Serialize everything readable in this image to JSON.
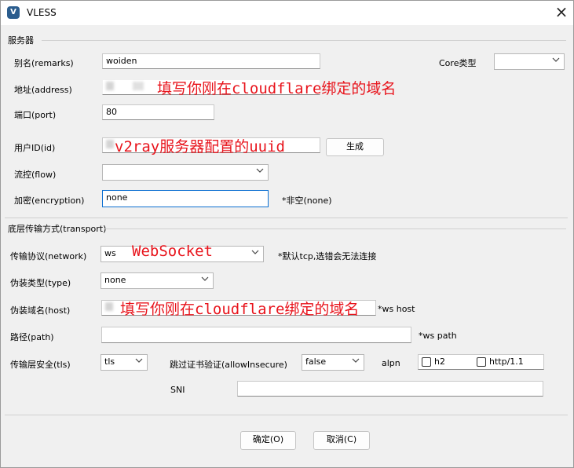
{
  "window": {
    "title": "VLESS",
    "icon": "V"
  },
  "server": {
    "section": "服务器",
    "remarks": {
      "label": "别名(remarks)",
      "value": "woiden"
    },
    "core": {
      "label": "Core类型",
      "value": ""
    },
    "address": {
      "label": "地址(address)",
      "annotation": "填写你刚在cloudflare绑定的域名"
    },
    "port": {
      "label": "端口(port)",
      "value": "80"
    },
    "uuid": {
      "label": "用户ID(id)",
      "annotation": "v2ray服务器配置的uuid",
      "generate": "生成"
    },
    "flow": {
      "label": "流控(flow)",
      "value": ""
    },
    "encryption": {
      "label": "加密(encryption)",
      "value": "none",
      "hint": "*非空(none)"
    }
  },
  "transport": {
    "section": "底层传输方式(transport)",
    "network": {
      "label": "传输协议(network)",
      "value": "ws",
      "annotation": "WebSocket",
      "hint": "*默认tcp,选错会无法连接"
    },
    "type": {
      "label": "伪装类型(type)",
      "value": "none"
    },
    "host": {
      "label": "伪装域名(host)",
      "annotation": "填写你刚在cloudflare绑定的域名",
      "hint": "*ws host"
    },
    "path": {
      "label": "路径(path)",
      "value": "",
      "hint": "*ws path"
    },
    "tls": {
      "label": "传输层安全(tls)",
      "value": "tls"
    },
    "allowInsecure": {
      "label": "跳过证书验证(allowInsecure)",
      "value": "false"
    },
    "alpn": {
      "label": "alpn",
      "options": [
        "h2",
        "http/1.1"
      ]
    },
    "sni": {
      "label": "SNI",
      "value": ""
    }
  },
  "buttons": {
    "ok": "确定(O)",
    "cancel": "取消(C)"
  },
  "colors": {
    "annotation": "#e8141c",
    "focus_border": "#0c6fd1"
  }
}
